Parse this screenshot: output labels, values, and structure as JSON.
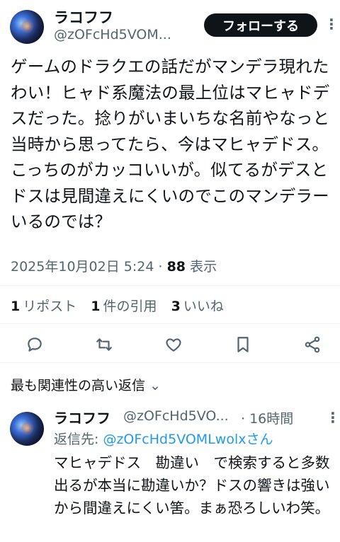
{
  "post": {
    "name": "ラコフフ",
    "handle": "@zOFcHd5VOM...",
    "follow_label": "フォローする",
    "more_label": "⋮",
    "text": "ゲームのドラクエの話だがマンデラ現れたわい！ヒャド系魔法の最上位はマヒャドデスだった。捻りがいまいちな名前やなっと当時から思ってたら、今はマヒャデドス。こっちのがカッコいいが。似てるがデスとドスは見間違えにくいのでこのマンデラーいるのでは？",
    "timestamp": "2025年10月02日 5:24",
    "separator": "·",
    "views_count": "88",
    "views_label": "表示"
  },
  "stats": {
    "reposts_count": "1",
    "reposts_label": "リポスト",
    "quotes_count": "1",
    "quotes_label": "件の引用",
    "likes_count": "3",
    "likes_label": "いいね"
  },
  "actions": [
    "reply-icon",
    "repost-icon",
    "like-icon",
    "bookmark-icon",
    "share-icon"
  ],
  "replies_header": {
    "label": "最も関連性の高い返信",
    "chevron": "⌄"
  },
  "reply": {
    "name": "ラコフフ",
    "handle": "@zOFcHd5VO...",
    "time": "· 16時間",
    "more_label": "⋮",
    "reply_to_label": "返信先: ",
    "reply_to_handle": "@zOFcHd5VOMLwolxさん",
    "text": "マヒャデドス　勘違い　で検索すると多数出るが本当に勘違いか？ドスの響きは強いから間違えにくい筈。まぁ恐ろしいわ笑。"
  },
  "colors": {
    "text": "#0f1419",
    "secondary": "#536471",
    "accent": "#1d9bf0",
    "button_bg": "#0f1419",
    "divider": "#eff3f4"
  }
}
